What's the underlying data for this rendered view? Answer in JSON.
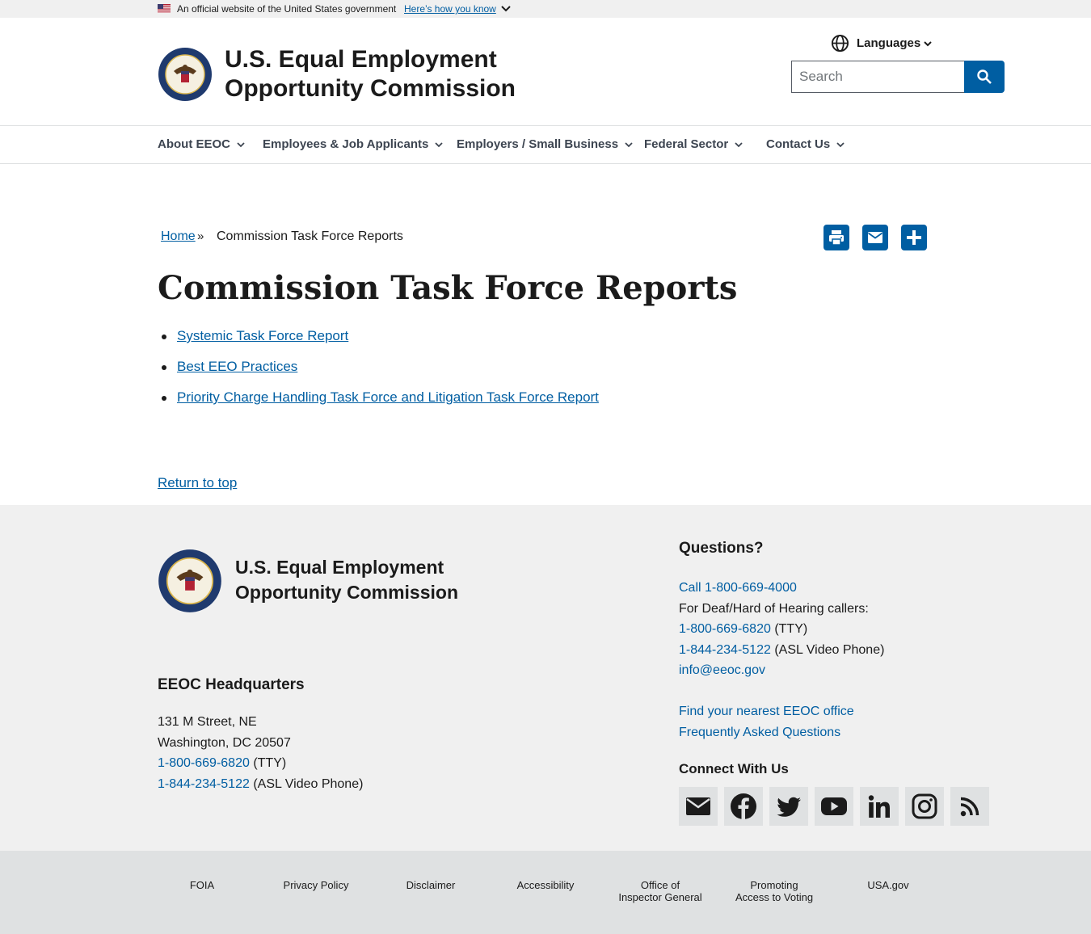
{
  "gov_banner": {
    "text": "An official website of the United States government",
    "link": "Here’s how you know"
  },
  "header": {
    "agency_line1": "U.S. Equal Employment",
    "agency_line2": "Opportunity Commission",
    "languages_label": "Languages",
    "search_placeholder": "Search"
  },
  "nav": {
    "items": [
      {
        "label": "About EEOC"
      },
      {
        "label": "Employees & Job Applicants"
      },
      {
        "label": "Employers / Small Business"
      },
      {
        "label": "Federal Sector"
      },
      {
        "label": "Contact Us"
      }
    ]
  },
  "breadcrumb": {
    "home": "Home",
    "separator": "»",
    "current": "Commission Task Force Reports"
  },
  "page": {
    "title": "Commission Task Force Reports",
    "links": [
      "Systemic Task Force Report",
      "Best EEO Practices",
      "Priority Charge Handling Task Force and Litigation Task Force Report"
    ],
    "return_to_top": "Return to top"
  },
  "share_icons": [
    "print-icon",
    "email-icon",
    "share-plus-icon"
  ],
  "footer": {
    "agency_line1": "U.S. Equal Employment",
    "agency_line2": "Opportunity Commission",
    "hq_heading": "EEOC Headquarters",
    "address_line1": "131 M Street, NE",
    "address_line2": "Washington, DC 20507",
    "hq_tty_number": "1-800-669-6820",
    "hq_tty_label": "(TTY)",
    "hq_asl_number": "1-844-234-5122",
    "hq_asl_label": "(ASL Video Phone)",
    "questions_heading": "Questions?",
    "call_link": "Call 1-800-669-4000",
    "deaf_text": "For Deaf/Hard of Hearing callers:",
    "tty_number": "1-800-669-6820",
    "tty_label": "(TTY)",
    "asl_number": "1-844-234-5122",
    "asl_label": "(ASL Video Phone)",
    "email": "info@eeoc.gov",
    "find_office": "Find your nearest EEOC office",
    "faq": "Frequently Asked Questions",
    "connect_heading": "Connect With Us",
    "social_icons": [
      "email-icon",
      "facebook-icon",
      "twitter-icon",
      "youtube-icon",
      "linkedin-icon",
      "instagram-icon",
      "rss-icon"
    ]
  },
  "bottom_links": [
    {
      "line1": "FOIA",
      "line2": ""
    },
    {
      "line1": "Privacy Policy",
      "line2": ""
    },
    {
      "line1": "Disclaimer",
      "line2": ""
    },
    {
      "line1": "Accessibility",
      "line2": ""
    },
    {
      "line1": "Office of",
      "line2": "Inspector General"
    },
    {
      "line1": "Promoting",
      "line2": "Access to Voting"
    },
    {
      "line1": "USA.gov",
      "line2": ""
    }
  ],
  "colors": {
    "primary": "#005ea2",
    "text": "#1b1b1b",
    "footer_bg": "#f0f0f0",
    "bottom_bg": "#dfe1e2"
  }
}
